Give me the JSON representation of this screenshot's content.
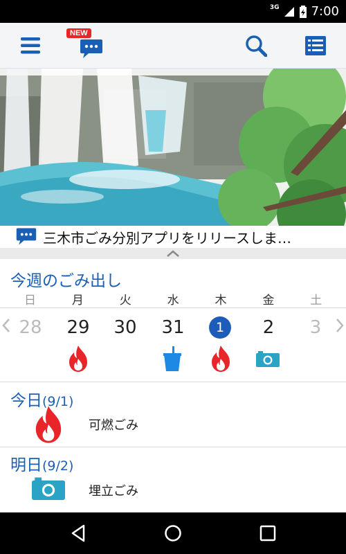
{
  "status_bar": {
    "network": "3G",
    "time": "7:00"
  },
  "app_bar": {
    "new_badge": "NEW",
    "icons": [
      "menu-icon",
      "chat-icon",
      "search-icon",
      "list-icon"
    ]
  },
  "news": {
    "text": "三木市ごみ分別アプリをリリースしま…"
  },
  "week": {
    "title": "今週のごみ出し",
    "day_headers": [
      "日",
      "月",
      "火",
      "水",
      "木",
      "金",
      "土"
    ],
    "dates": [
      "28",
      "29",
      "30",
      "31",
      "1",
      "2",
      "3"
    ],
    "today_index": 4,
    "icons": [
      "",
      "fire-icon",
      "",
      "bucket-icon",
      "fire-icon",
      "camera-icon",
      ""
    ]
  },
  "today": {
    "label": "今日",
    "date": "(9/1)",
    "item_label": "可燃ごみ",
    "item_icon": "fire-icon"
  },
  "tomorrow": {
    "label": "明日",
    "date": "(9/2)",
    "item_label": "埋立ごみ",
    "item_icon": "camera-icon"
  },
  "colors": {
    "accent_blue": "#1a5fb4",
    "fire_red": "#e8262a",
    "teal": "#2aa3c4",
    "bucket_blue": "#1e88e5"
  }
}
